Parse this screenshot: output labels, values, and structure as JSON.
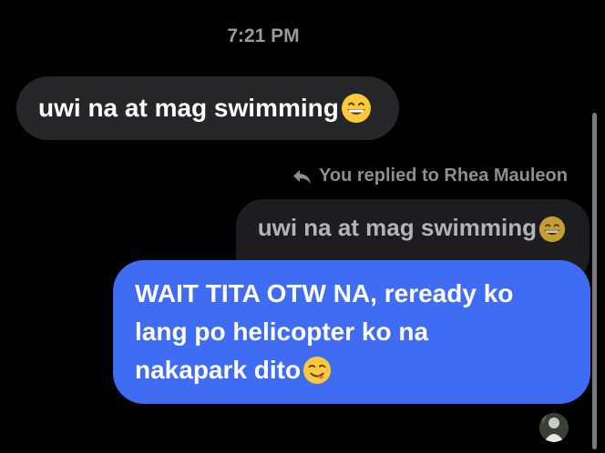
{
  "chat": {
    "timestamp": "7:21 PM",
    "incoming_message": {
      "text": "uwi na at mag swimming",
      "emoji": "grinning-face-with-smiling-eyes"
    },
    "reply_indicator": {
      "icon": "reply-arrow-icon",
      "text": "You replied to Rhea Mauleon"
    },
    "quoted_message": {
      "text": "uwi na at mag swimming",
      "emoji": "grinning-face-with-smiling-eyes"
    },
    "outgoing_message": {
      "line1": "WAIT TITA OTW NA, reready ko",
      "line2": "lang po helicopter ko na",
      "line3": "nakapark dito",
      "emoji": "face-savoring-food"
    },
    "colors": {
      "background": "#000000",
      "incoming_bubble": "#262628",
      "quoted_bubble": "#1d1d1f",
      "outgoing_bubble": "#3f6cf2",
      "meta_text": "#8d8d92"
    }
  }
}
